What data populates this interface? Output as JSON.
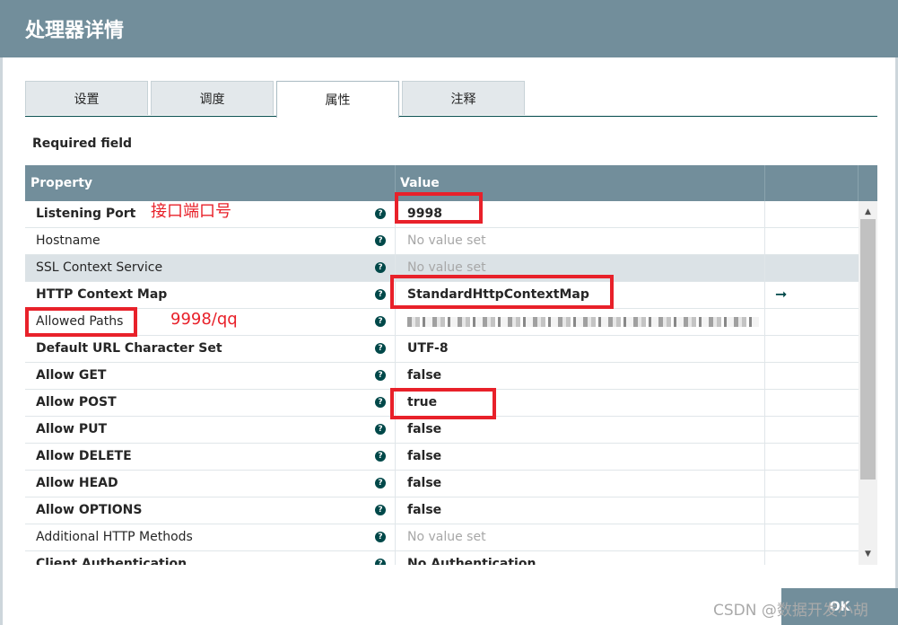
{
  "dialog": {
    "title": "处理器详情",
    "ok_label": "OK"
  },
  "tabs": [
    {
      "label": "设置"
    },
    {
      "label": "调度"
    },
    {
      "label": "属性"
    },
    {
      "label": "注释"
    }
  ],
  "active_tab": "属性",
  "required_field_label": "Required field",
  "table": {
    "headers": {
      "property": "Property",
      "value": "Value"
    },
    "rows": [
      {
        "property": "Listening Port",
        "value": "9998",
        "required": true,
        "empty": false
      },
      {
        "property": "Hostname",
        "value": "No value set",
        "required": false,
        "empty": true
      },
      {
        "property": "SSL Context Service",
        "value": "No value set",
        "required": false,
        "empty": true,
        "selected": true
      },
      {
        "property": "HTTP Context Map",
        "value": "StandardHttpContextMap",
        "required": true,
        "empty": false,
        "action": "arrow-right-icon"
      },
      {
        "property": "Allowed Paths",
        "value": "",
        "required": false,
        "empty": false,
        "blurred": true
      },
      {
        "property": "Default URL Character Set",
        "value": "UTF-8",
        "required": true,
        "empty": false
      },
      {
        "property": "Allow GET",
        "value": "false",
        "required": true,
        "empty": false
      },
      {
        "property": "Allow POST",
        "value": "true",
        "required": true,
        "empty": false
      },
      {
        "property": "Allow PUT",
        "value": "false",
        "required": true,
        "empty": false
      },
      {
        "property": "Allow DELETE",
        "value": "false",
        "required": true,
        "empty": false
      },
      {
        "property": "Allow HEAD",
        "value": "false",
        "required": true,
        "empty": false
      },
      {
        "property": "Allow OPTIONS",
        "value": "false",
        "required": true,
        "empty": false
      },
      {
        "property": "Additional HTTP Methods",
        "value": "No value set",
        "required": false,
        "empty": true
      },
      {
        "property": "Client Authentication",
        "value": "No Authentication",
        "required": true,
        "empty": false
      }
    ]
  },
  "annotations": {
    "listening_port_note": "接口端口号",
    "allowed_paths_note": "9998/qq"
  },
  "watermark": "CSDN @数据开发小胡",
  "colors": {
    "header_bg": "#728e9b",
    "accent": "#004849",
    "annotation_red": "#e8212a",
    "empty_value": "#a7a7a7"
  }
}
